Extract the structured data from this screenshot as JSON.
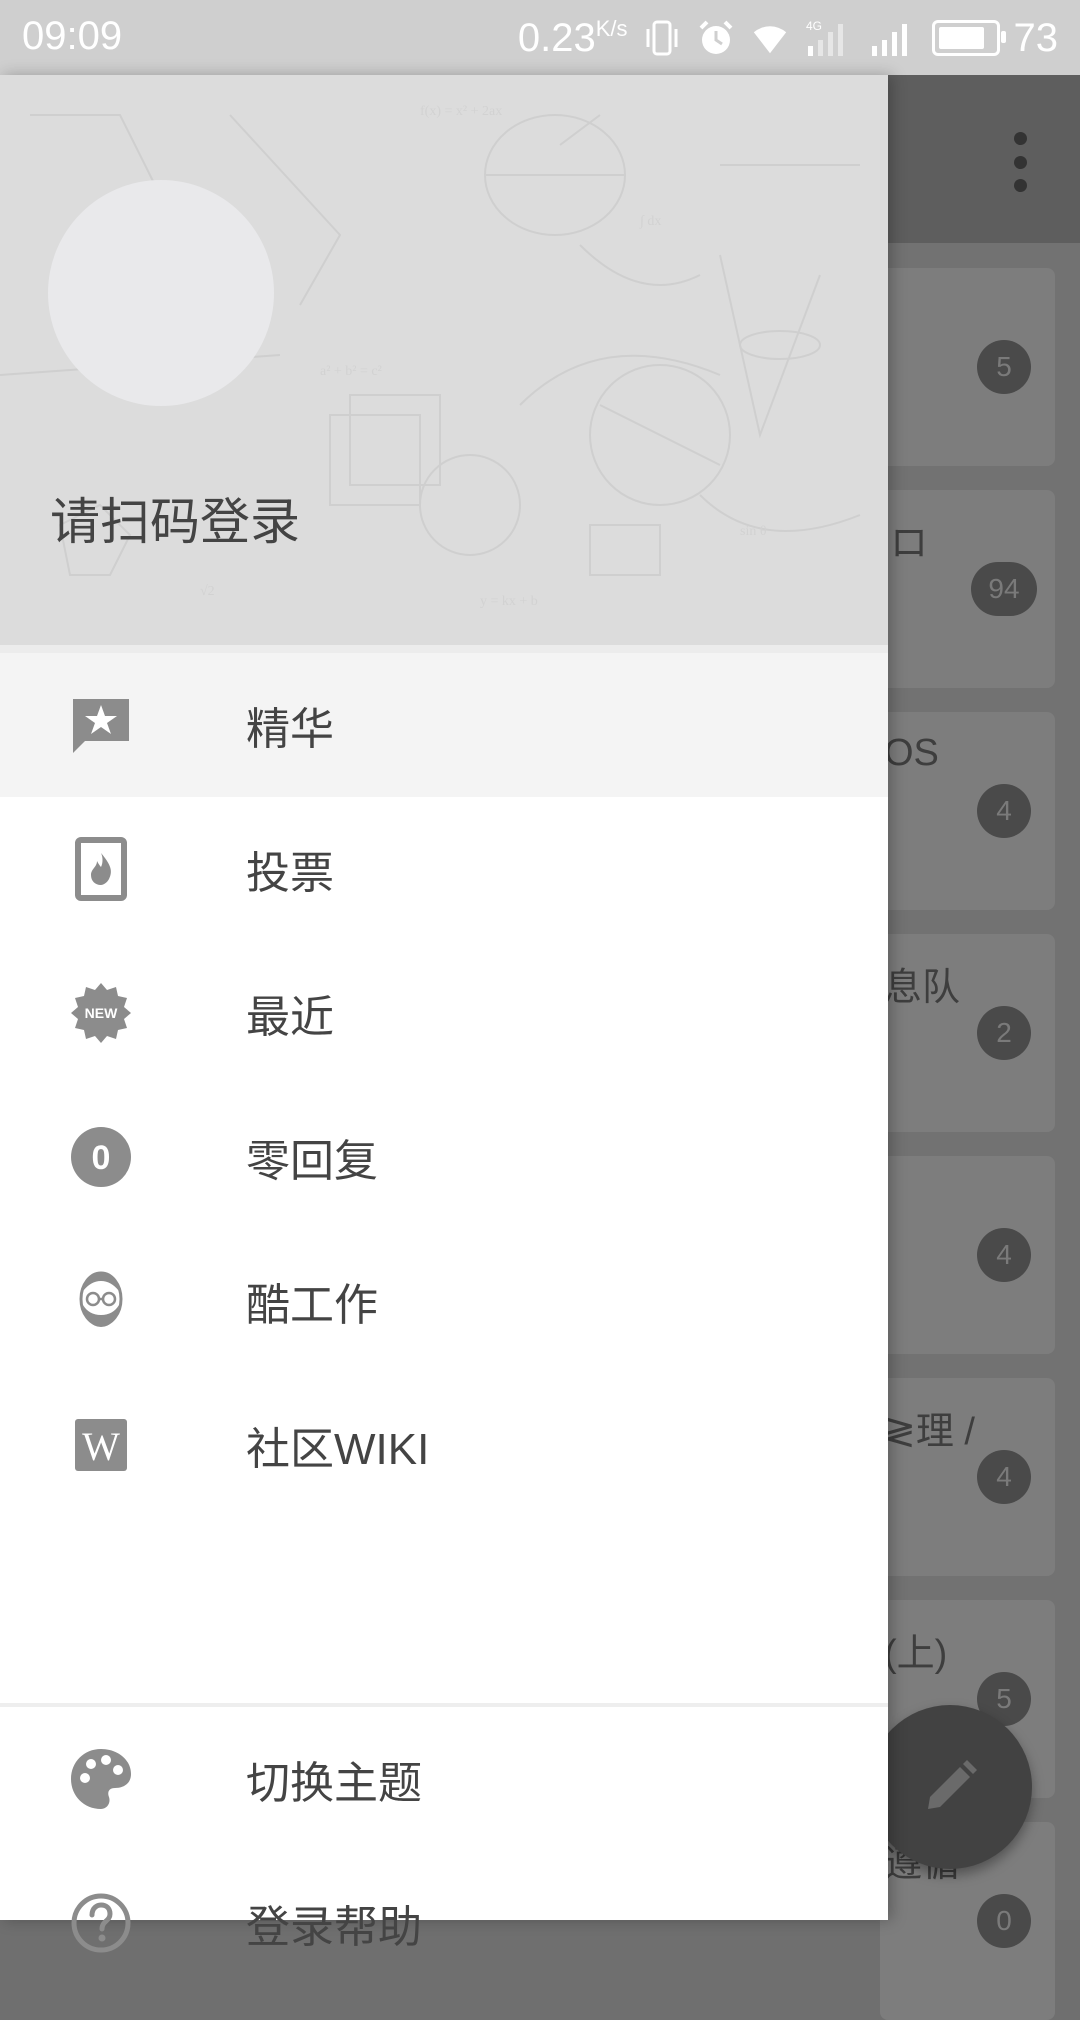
{
  "status_bar": {
    "time": "09:09",
    "net_speed": "0.23",
    "net_speed_unit": "K/s",
    "network_type": "4G",
    "battery_level": "73"
  },
  "background_list": {
    "cards": [
      {
        "snippet": "",
        "count": "5"
      },
      {
        "snippet": "ロ",
        "count": "94"
      },
      {
        "snippet": "OS",
        "count": "4"
      },
      {
        "snippet": "息队",
        "count": "2"
      },
      {
        "snippet": "",
        "count": "4"
      },
      {
        "snippet": "≷理 /",
        "count": "4"
      },
      {
        "snippet": "(上)",
        "count": "5"
      },
      {
        "snippet": "遵循",
        "count": "0"
      }
    ]
  },
  "drawer": {
    "login_prompt": "请扫码登录",
    "menu": [
      {
        "label": "精华",
        "icon": "star-comment-icon"
      },
      {
        "label": "投票",
        "icon": "fire-card-icon"
      },
      {
        "label": "最近",
        "icon": "new-badge-icon"
      },
      {
        "label": "零回复",
        "icon": "zero-circle-icon"
      },
      {
        "label": "酷工作",
        "icon": "bearded-face-icon"
      },
      {
        "label": "社区WIKI",
        "icon": "wikipedia-icon"
      }
    ],
    "footer_menu": [
      {
        "label": "切换主题",
        "icon": "palette-icon"
      },
      {
        "label": "登录帮助",
        "icon": "help-circle-icon"
      }
    ],
    "new_badge_text": "NEW",
    "zero_badge_text": "0",
    "wiki_badge_text": "W"
  },
  "colors": {
    "drawer_bg": "#ffffff",
    "header_bg": "#dcdcdc",
    "icon_gray": "#8c8c8c",
    "text": "#444444",
    "fab": "#424242"
  }
}
